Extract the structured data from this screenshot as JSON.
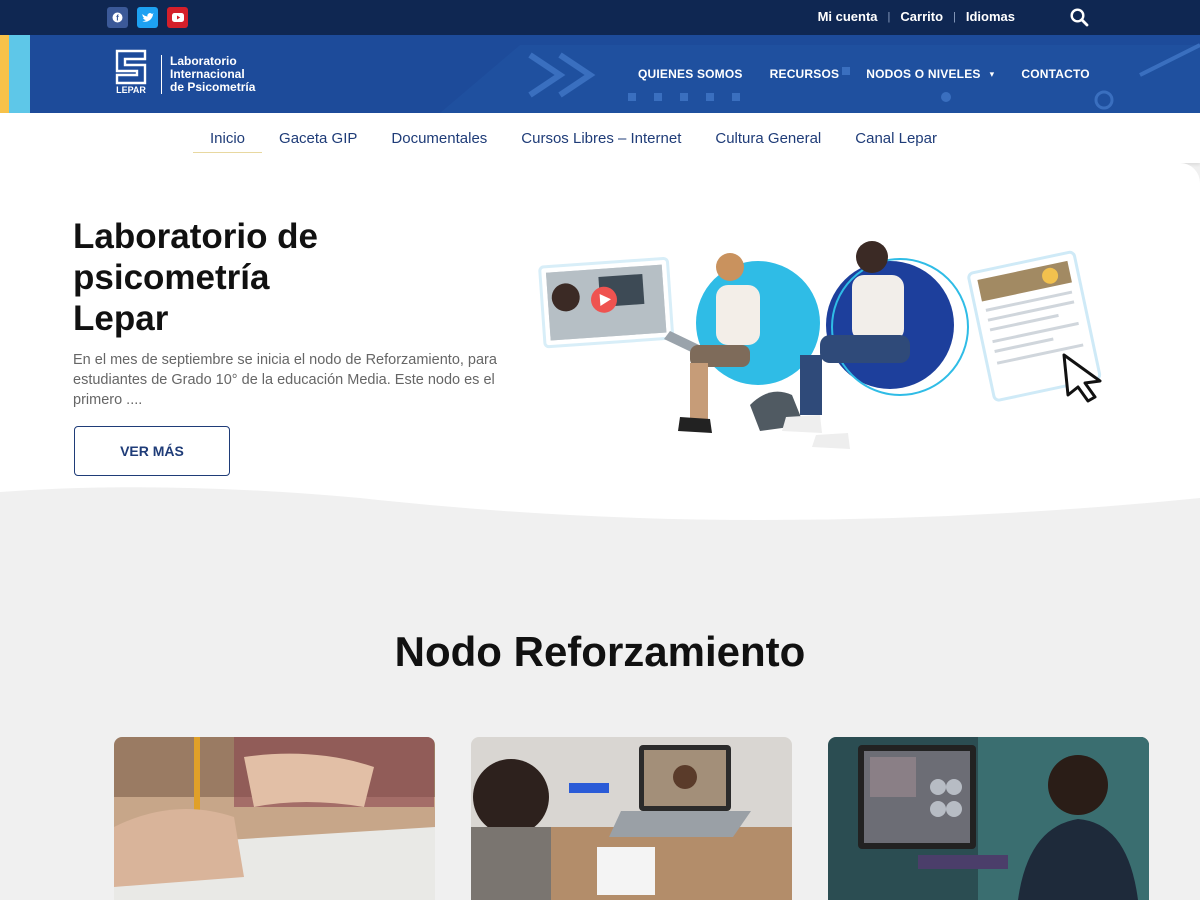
{
  "topbar": {
    "social": [
      {
        "icon": "facebook-icon",
        "color": "#3b5998",
        "glyph": "f"
      },
      {
        "icon": "twitter-icon",
        "color": "#1da1f2",
        "glyph": "t"
      },
      {
        "icon": "youtube-icon",
        "color": "#e02020",
        "glyph": "▶"
      }
    ],
    "links": [
      "Mi cuenta",
      "Carrito",
      "Idiomas"
    ],
    "separator": "|"
  },
  "logo": {
    "mark_label": "LEPAR",
    "line1": "Laboratorio",
    "line2": "Internacional",
    "line3": "de Psicometría"
  },
  "main_nav": {
    "items": [
      "QUIENES SOMOS",
      "RECURSOS",
      "NODOS O NIVELES",
      "CONTACTO"
    ],
    "dropdown_caret": "▾"
  },
  "sub_nav": {
    "tabs": [
      "Inicio",
      "Gaceta GIP",
      "Documentales",
      "Cursos Libres – Internet",
      "Cultura General",
      "Canal Lepar"
    ],
    "active": "Inicio"
  },
  "hero": {
    "title_line1": "Laboratorio de",
    "title_line2": "psicometría",
    "title_line3": "Lepar",
    "description": "En el mes de septiembre se inicia el nodo de Reforzamiento, para estudiantes de Grado 10° de la educación Media. Este nodo es el primero ....",
    "button": "VER MÁS"
  },
  "section": {
    "title": "Nodo Reforzamiento"
  },
  "colors": {
    "topbar": "#0f2752",
    "header": "#1d4b9a",
    "accent_yellow": "#f7c24a",
    "accent_cyan": "#5ec7e8",
    "nav_text": "#1f3c78"
  }
}
